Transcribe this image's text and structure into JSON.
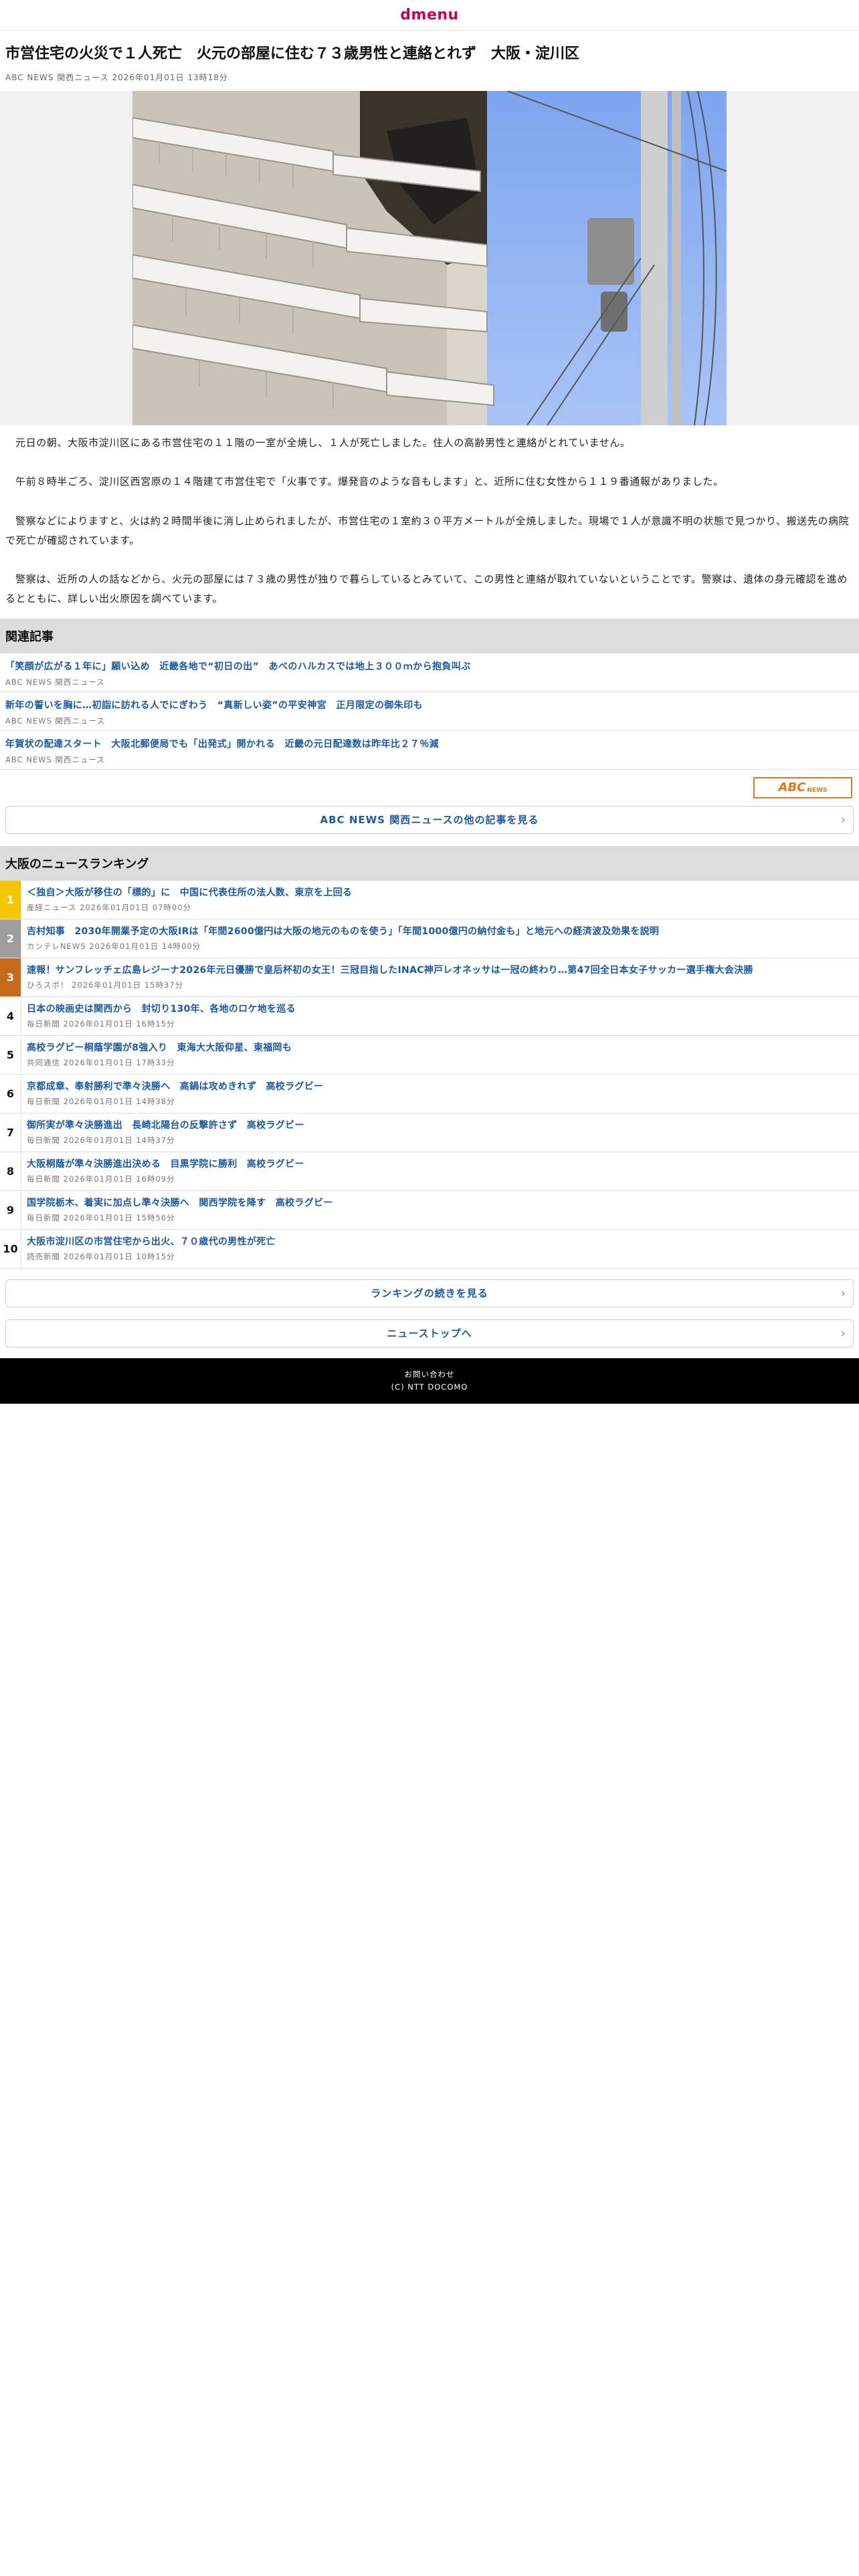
{
  "header": {
    "logo": "dmenu"
  },
  "article": {
    "title": "市営住宅の火災で１人死亡　火元の部屋に住む７３歳男性と連絡とれず　大阪・淀川区",
    "meta": "ABC NEWS 関西ニュース 2026年01月01日 13時18分",
    "paragraphs": [
      "元日の朝、大阪市淀川区にある市営住宅の１１階の一室が全焼し、１人が死亡しました。住人の高齢男性と連絡がとれていません。",
      "午前８時半ごろ、淀川区西宮原の１４階建て市営住宅で「火事です。爆発音のような音もします」と、近所に住む女性から１１９番通報がありました。",
      "警察などによりますと、火は約２時間半後に消し止められましたが、市営住宅の１室約３０平方メートルが全焼しました。現場で１人が意識不明の状態で見つかり、搬送先の病院で死亡が確認されています。",
      "警察は、近所の人の話などから、火元の部屋には７３歳の男性が独りで暮らしているとみていて、この男性と連絡が取れていないということです。警察は、遺体の身元確認を進めるとともに、詳しい出火原因を調べています。"
    ]
  },
  "related": {
    "heading": "関連記事",
    "items": [
      {
        "title": "「笑顔が広がる１年に」願い込め　近畿各地で“初日の出”　あべのハルカスでは地上３００ｍから抱負叫ぶ",
        "source": "ABC NEWS 関西ニュース"
      },
      {
        "title": "新年の誓いを胸に…初詣に訪れる人でにぎわう　“真新しい姿”の平安神宮　正月限定の御朱印も",
        "source": "ABC NEWS 関西ニュース"
      },
      {
        "title": "年賀状の配達スタート　大阪北郵便局でも「出発式」開かれる　近畿の元日配達数は昨年比２７％減",
        "source": "ABC NEWS 関西ニュース"
      }
    ],
    "logo_text": "ABC",
    "logo_sub": "NEWS",
    "more_button": "ABC NEWS 関西ニュースの他の記事を見る"
  },
  "ranking": {
    "heading": "大阪のニュースランキング",
    "items": [
      {
        "rank": "1",
        "title": "＜独自＞大阪が移住の「標的」に　中国に代表住所の法人数、東京を上回る",
        "source": "産経ニュース 2026年01月01日 07時00分"
      },
      {
        "rank": "2",
        "title": "吉村知事　2030年開業予定の大阪IRは「年間2600億円は大阪の地元のものを使う」「年間1000億円の納付金も」と地元への経済波及効果を説明",
        "source": "カンテレNEWS 2026年01月01日 14時00分"
      },
      {
        "rank": "3",
        "title": "速報！サンフレッチェ広島レジーナ2026年元日優勝で皇后杯初の女王！三冠目指したINAC神戸レオネッサは一冠の終わり…第47回全日本女子サッカー選手権大会決勝",
        "source": "ひろスポ！ 2026年01月01日 15時37分"
      },
      {
        "rank": "4",
        "title": "日本の映画史は関西から　封切り130年、各地のロケ地を巡る",
        "source": "毎日新聞 2026年01月01日 16時15分"
      },
      {
        "rank": "5",
        "title": "高校ラグビー桐蔭学園が8強入り　東海大大阪仰星、東福岡も",
        "source": "共同通信 2026年01月01日 17時33分"
      },
      {
        "rank": "6",
        "title": "京都成章、奉射勝利で準々決勝へ　高鍋は攻めきれず　高校ラグビー",
        "source": "毎日新聞 2026年01月01日 14時38分"
      },
      {
        "rank": "7",
        "title": "御所実が準々決勝進出　長崎北陽台の反撃許さず　高校ラグビー",
        "source": "毎日新聞 2026年01月01日 14時37分"
      },
      {
        "rank": "8",
        "title": "大阪桐蔭が準々決勝進出決める　目黒学院に勝利　高校ラグビー",
        "source": "毎日新聞 2026年01月01日 16時09分"
      },
      {
        "rank": "9",
        "title": "国学院栃木、着実に加点し準々決勝へ　関西学院を降す　高校ラグビー",
        "source": "毎日新聞 2026年01月01日 15時56分"
      },
      {
        "rank": "10",
        "title": "大阪市淀川区の市営住宅から出火、７０歳代の男性が死亡",
        "source": "読売新聞 2026年01月01日 10時15分"
      }
    ],
    "more_button": "ランキングの続きを見る",
    "top_button": "ニューストップへ"
  },
  "footer": {
    "contact": "お問い合わせ",
    "copyright": "(C) NTT DOCOMO"
  },
  "colors": {
    "brand": "#c8004e",
    "link": "#1a5aa0",
    "rank1": "#f3c600",
    "rank2": "#9e9e9e",
    "rank3": "#c76a1c",
    "abc": "#e07a18"
  }
}
